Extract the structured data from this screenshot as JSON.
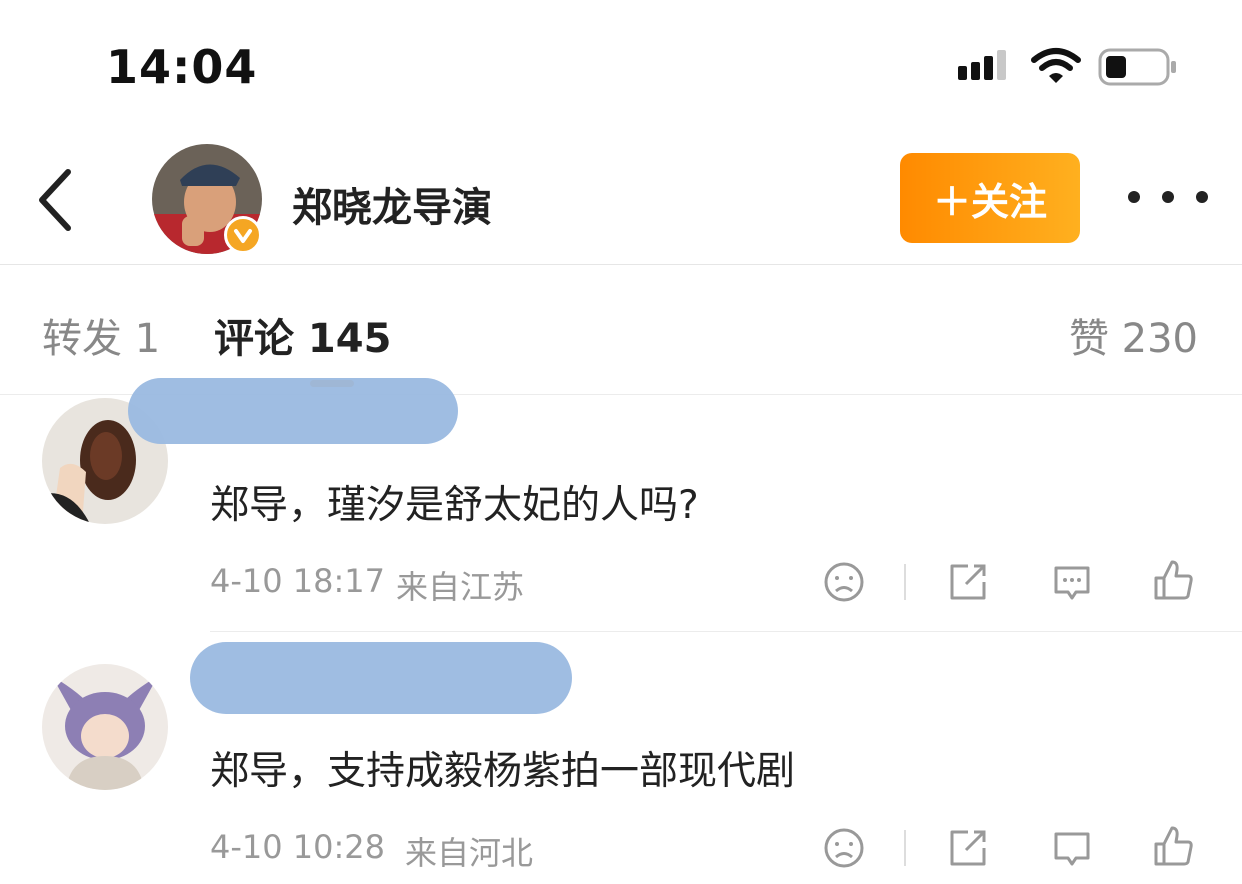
{
  "status_bar": {
    "time": "14:04"
  },
  "header": {
    "author_name": "郑晓龙导演",
    "follow_label": "＋关注"
  },
  "tabs": {
    "repost": "转发 1",
    "comments": "评论 145",
    "likes": "赞 230"
  },
  "comments": [
    {
      "text": "郑导，瑾汐是舒太妃的人吗?",
      "timestamp": "4-10 18:17",
      "location": "来自江苏"
    },
    {
      "text": "郑导，支持成毅杨紫拍一部现代剧",
      "timestamp": "4-10 10:28",
      "location": "来自河北"
    }
  ],
  "colors": {
    "accent": "#ff8200",
    "follow_start": "#ff8a00",
    "follow_end": "#ffb01f",
    "verified": "#f5a623"
  },
  "icons": [
    "signal-icon",
    "wifi-icon",
    "battery-icon",
    "back-icon",
    "verified-icon",
    "more-icon",
    "dislike-icon",
    "share-icon",
    "reply-icon",
    "like-icon"
  ]
}
